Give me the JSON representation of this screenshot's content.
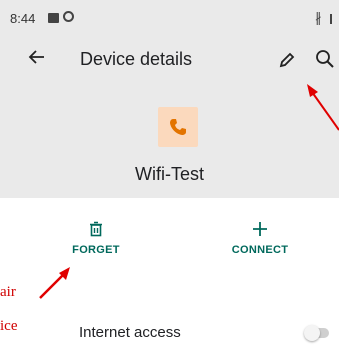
{
  "status_bar": {
    "time": "8:44",
    "bluetooth_icon": "bluetooth-icon",
    "image_icon": "image-icon",
    "sync_icon": "sync-icon"
  },
  "app_bar": {
    "title": "Device details",
    "back_icon": "arrow-left-icon",
    "edit_icon": "pencil-icon",
    "search_icon": "search-icon"
  },
  "device": {
    "name": "Wifi-Test",
    "icon": "phone-icon",
    "icon_bg_color": "#fbd9bd",
    "icon_color": "#e37400"
  },
  "actions": {
    "forget_label": "FORGET",
    "connect_label": "CONNECT",
    "accent_color": "#00695c"
  },
  "settings": {
    "internet_access_label": "Internet access",
    "internet_access_enabled": false
  },
  "annotations": {
    "line1": "air",
    "line2": "ice",
    "color": "#d00000"
  }
}
